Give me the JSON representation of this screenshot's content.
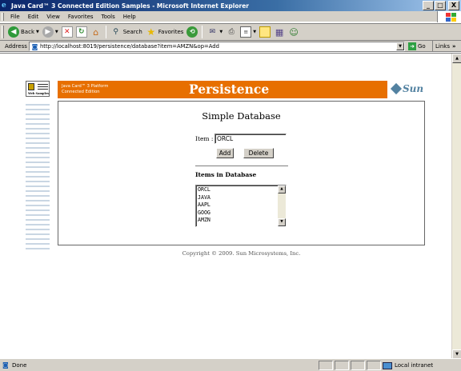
{
  "window": {
    "title": "Java Card™ 3 Connected Edition Samples - Microsoft Internet Explorer",
    "minimize": "_",
    "maximize": "□",
    "close": "X"
  },
  "menu": [
    "File",
    "Edit",
    "View",
    "Favorites",
    "Tools",
    "Help"
  ],
  "toolbar": {
    "back": "Back",
    "search": "Search",
    "favorites": "Favorites"
  },
  "address": {
    "label": "Address",
    "url": "http://localhost:8019/persistence/database?item=AMZN&op=Add",
    "go": "Go",
    "links": "Links"
  },
  "page": {
    "logo_text": "Web Samples",
    "platform_line1": "Java Card™ 3 Platform",
    "platform_line2": "Connected Edition",
    "heading": "Persistence",
    "sun": "Sun",
    "title": "Simple Database",
    "item_label": "Item :",
    "item_value": "ORCL",
    "add_button": "Add",
    "delete_button": "Delete",
    "items_heading": "Items in Database",
    "items": [
      "ORCL",
      "JAVA",
      "AAPL",
      "GOOG",
      "AMZN"
    ],
    "copyright": "Copyright © 2009. Sun Microsystems, Inc."
  },
  "status": {
    "text": "Done",
    "zone": "Local intranet"
  }
}
